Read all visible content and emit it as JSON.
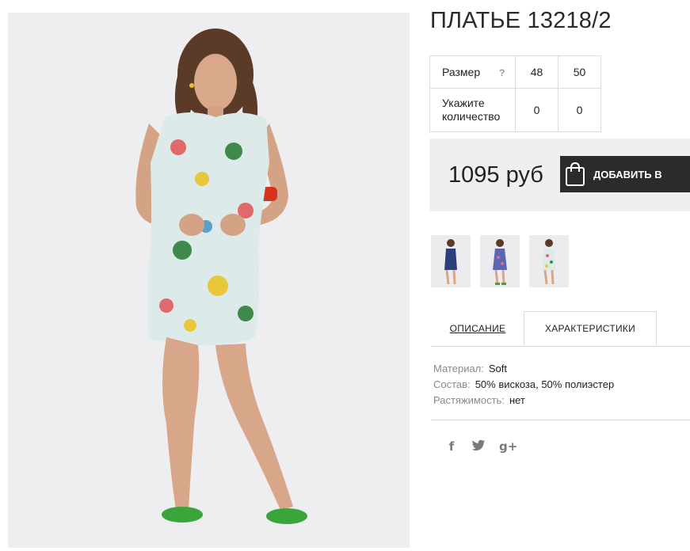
{
  "product": {
    "title": "ПЛАТЬЕ 13218/2",
    "size_label": "Размер",
    "size_help": "?",
    "sizes": [
      "48",
      "50"
    ],
    "qty_label_1": "Укажите",
    "qty_label_2": "количество",
    "quantities": [
      "0",
      "0"
    ],
    "price": "1095 руб",
    "add_button": "ДОБАВИТЬ В",
    "thumbnails": [
      "navy-dress-thumb",
      "blue-print-dress-thumb",
      "floral-dress-thumb"
    ]
  },
  "tabs": {
    "description": "ОПИСАНИЕ",
    "specs": "ХАРАКТЕРИСТИКИ",
    "active": "specs"
  },
  "specs": [
    {
      "key": "Материал:",
      "value": "Soft"
    },
    {
      "key": "Состав:",
      "value": "50% вискоза, 50% полиэстер"
    },
    {
      "key": "Растяжимость:",
      "value": "нет"
    }
  ],
  "social": {
    "icons": [
      "facebook-icon",
      "twitter-icon",
      "google-plus-icon"
    ],
    "facebook": "f",
    "google_plus": "g+"
  },
  "colors": {
    "button_bg": "#2b2b2b",
    "buybox_bg": "#efefef",
    "photo_bg": "#eeeef0",
    "sandal_green": "#3aa53a"
  }
}
